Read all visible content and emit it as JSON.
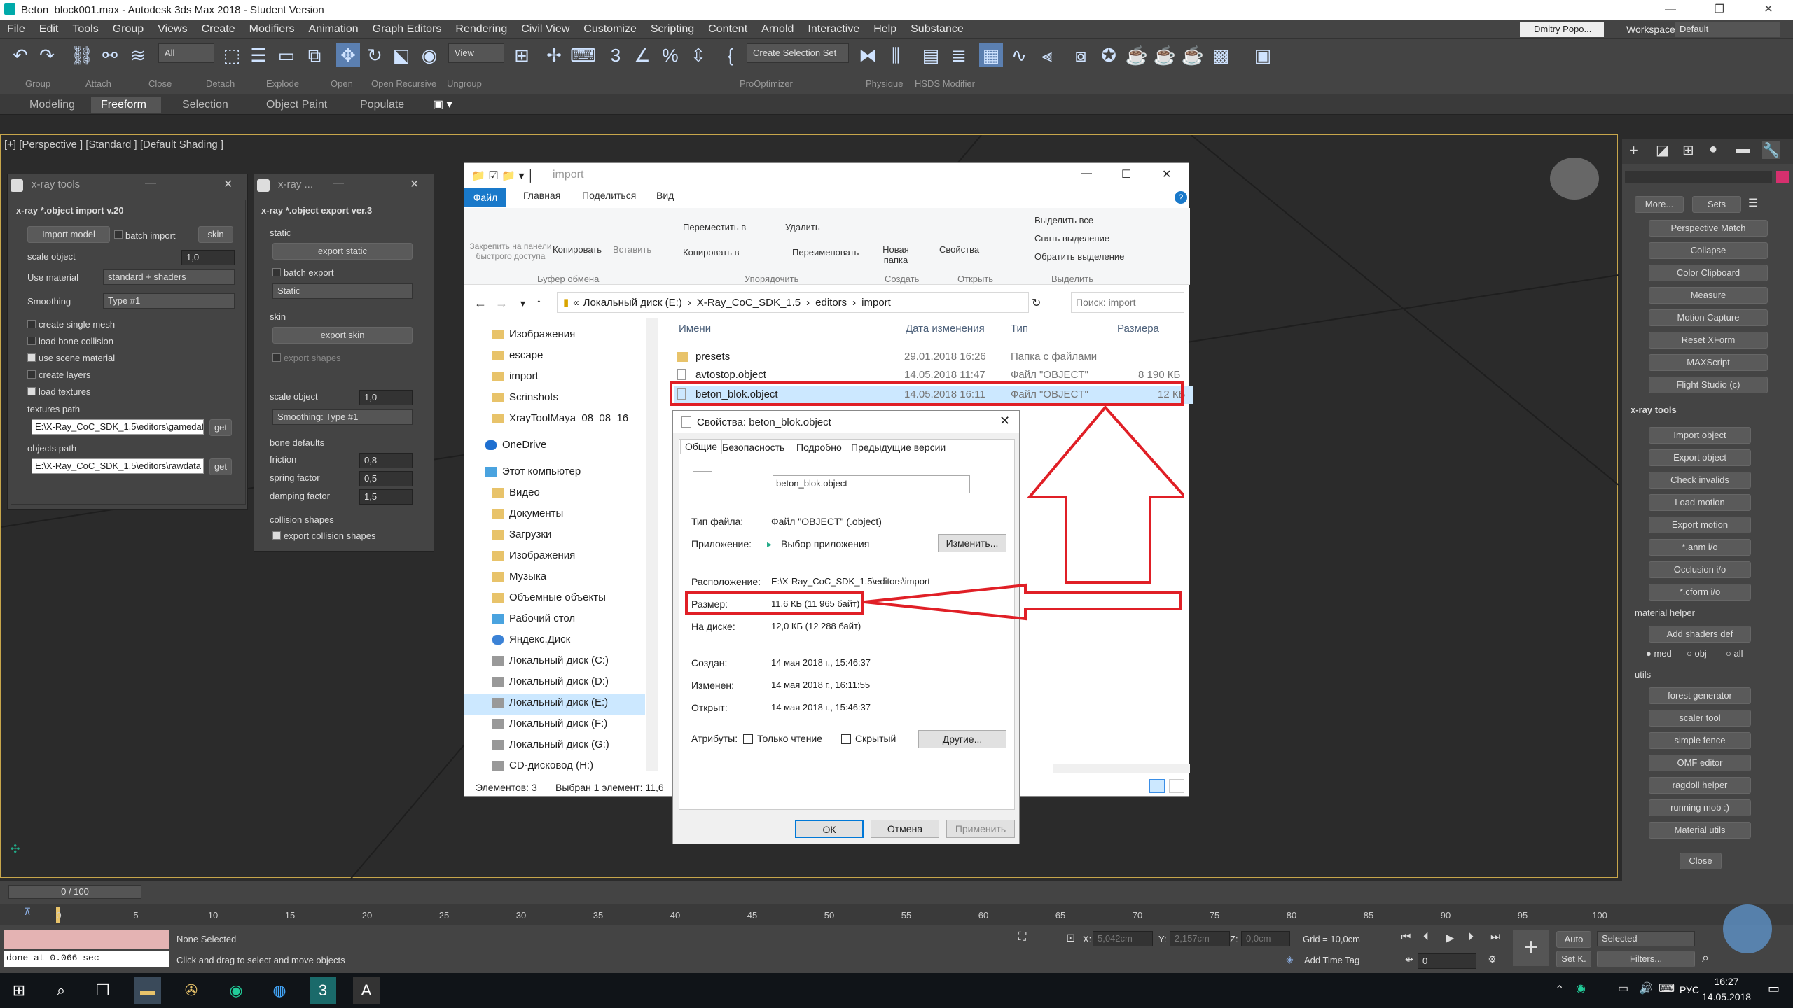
{
  "titlebar": {
    "title": "Beton_block001.max - Autodesk 3ds Max 2018 - Student Version"
  },
  "menu": [
    "File",
    "Edit",
    "Tools",
    "Group",
    "Views",
    "Create",
    "Modifiers",
    "Animation",
    "Graph Editors",
    "Rendering",
    "Civil View",
    "Customize",
    "Scripting",
    "Content",
    "Arnold",
    "Interactive",
    "Help",
    "Substance"
  ],
  "user": {
    "name": "Dmitry Popo...",
    "workspaces_label": "Workspaces:",
    "workspace": "Default"
  },
  "toolbar": {
    "filter": "All",
    "view": "View",
    "selection_set": "Create Selection Set"
  },
  "second_toolbar": [
    "Group",
    "Attach",
    "Close",
    "Detach",
    "Explode",
    "Open",
    "Open Recursive",
    "Ungroup",
    "ProOptimizer",
    "Physique",
    "HSDS Modifier"
  ],
  "ribbon": {
    "tabs": [
      "Modeling",
      "Freeform",
      "Selection",
      "Object Paint",
      "Populate"
    ],
    "active": "Freeform"
  },
  "viewport": {
    "label": "[+] [Perspective ] [Standard ] [Default Shading ]"
  },
  "xray_import": {
    "window_title": "x-ray tools",
    "rollout": "x-ray *.object import v.20",
    "import_model": "Import model",
    "batch_import": "batch import",
    "skin": "skin",
    "scale_label": "scale object",
    "scale_value": "1,0",
    "use_material_label": "Use material",
    "use_material_value": "standard + shaders",
    "smoothing_label": "Smoothing",
    "smoothing_value": "Type #1",
    "checks": [
      "create single mesh",
      "load bone collision",
      "use scene material",
      "create layers",
      "load textures"
    ],
    "textures_path_label": "textures path",
    "textures_path": "E:\\X-Ray_CoC_SDK_1.5\\editors\\gamedat",
    "objects_path_label": "objects path",
    "objects_path": "E:\\X-Ray_CoC_SDK_1.5\\editors\\rawdata",
    "get": "get"
  },
  "xray_export": {
    "window_title": "x-ray ...",
    "rollout": "x-ray *.object export ver.3",
    "static_label": "static",
    "export_static": "export static",
    "batch_export": "batch export",
    "static_value": "Static",
    "skin_label": "skin",
    "export_skin": "export skin",
    "export_shapes": "export shapes",
    "scale_label": "scale object",
    "scale_value": "1,0",
    "smoothing_value": "Smoothing: Type #1",
    "bone_defaults": "bone defaults",
    "friction_label": "friction",
    "friction": "0,8",
    "spring_label": "spring factor",
    "spring": "0,5",
    "damping_label": "damping factor",
    "damping": "1,5",
    "collision_label": "collision shapes",
    "collision_export": "export collision shapes"
  },
  "explorer": {
    "title": "import",
    "tabs": [
      "Файл",
      "Главная",
      "Поделиться",
      "Вид"
    ],
    "ribbon_buttons": {
      "pin": "Закрепить на панели быстрого доступа",
      "copy": "Копировать",
      "paste": "Вставить",
      "move_to": "Переместить в",
      "copy_to": "Копировать в",
      "delete": "Удалить",
      "rename": "Переименовать",
      "new_folder": "Новая папка",
      "properties": "Свойства",
      "select_all": "Выделить все",
      "deselect": "Снять выделение",
      "invert": "Обратить выделение"
    },
    "groups": [
      "Буфер обмена",
      "Упорядочить",
      "Создать",
      "Открыть",
      "Выделить"
    ],
    "breadcrumb": [
      "Локальный диск (E:)",
      "X-Ray_CoC_SDK_1.5",
      "editors",
      "import"
    ],
    "search_placeholder": "Поиск: import",
    "nav": [
      "Изображения",
      "escape",
      "import",
      "Scrinshots",
      "XrayToolMaya_08_08_16",
      "OneDrive",
      "Этот компьютер",
      "Видео",
      "Документы",
      "Загрузки",
      "Изображения",
      "Музыка",
      "Объемные объекты",
      "Рабочий стол",
      "Яндекс.Диск",
      "Локальный диск (C:)",
      "Локальный диск (D:)",
      "Локальный диск (E:)",
      "Локальный диск (F:)",
      "Локальный диск (G:)",
      "CD-дисковод (H:)"
    ],
    "columns": [
      "Имени",
      "Дата изменения",
      "Тип",
      "Размера"
    ],
    "files": [
      {
        "name": "presets",
        "date": "29.01.2018 16:26",
        "type": "Папка с файлами",
        "size": ""
      },
      {
        "name": "avtostop.object",
        "date": "14.05.2018 11:47",
        "type": "Файл \"OBJECT\"",
        "size": "8 190 КБ"
      },
      {
        "name": "beton_blok.object",
        "date": "14.05.2018 16:11",
        "type": "Файл \"OBJECT\"",
        "size": "12 КБ"
      }
    ],
    "status_items": "Элементов: 3",
    "status_selected": "Выбран 1 элемент: 11,6"
  },
  "props": {
    "title": "Свойства: beton_blok.object",
    "tabs": [
      "Общие",
      "Безопасность",
      "Подробно",
      "Предыдущие версии"
    ],
    "filename": "beton_blok.object",
    "type_label": "Тип файла:",
    "type_value": "Файл \"OBJECT\" (.object)",
    "app_label": "Приложение:",
    "app_value": "Выбор приложения",
    "change": "Изменить...",
    "loc_label": "Расположение:",
    "loc_value": "E:\\X-Ray_CoC_SDK_1.5\\editors\\import",
    "size_label": "Размер:",
    "size_value": "11,6 КБ (11 965 байт)",
    "disk_label": "На диске:",
    "disk_value": "12,0 КБ (12 288 байт)",
    "created_label": "Создан:",
    "created_value": "14 мая 2018 г., 15:46:37",
    "modified_label": "Изменен:",
    "modified_value": "14 мая 2018 г., 16:11:55",
    "opened_label": "Открыт:",
    "opened_value": "14 мая 2018 г., 15:46:37",
    "attr_label": "Атрибуты:",
    "readonly": "Только чтение",
    "hidden": "Скрытый",
    "other": "Другие...",
    "ok": "ОК",
    "cancel": "Отмена",
    "apply": "Применить"
  },
  "cmdpanel": {
    "more": "More...",
    "sets": "Sets",
    "buttons": [
      "Perspective Match",
      "Collapse",
      "Color Clipboard",
      "Measure",
      "Motion Capture",
      "Reset XForm",
      "MAXScript",
      "Flight Studio (c)"
    ],
    "xray_rollout": "x-ray tools",
    "xray_buttons": [
      "Import object",
      "Export object",
      "Check invalids",
      "Load motion",
      "Export motion",
      "*.anm i/o",
      "Occlusion i/o",
      "*.cform i/o"
    ],
    "material_helper": "material helper",
    "add_shaders": "Add shaders def",
    "radios": [
      "med",
      "obj",
      "all"
    ],
    "utils": "utils",
    "utils_buttons": [
      "forest generator",
      "scaler tool",
      "simple fence",
      "OMF editor",
      "ragdoll helper",
      "running mob :)",
      "Material utils"
    ],
    "close": "Close"
  },
  "timeline": {
    "frame": "0 / 100",
    "ticks": [
      "0",
      "5",
      "10",
      "15",
      "20",
      "25",
      "30",
      "35",
      "40",
      "45",
      "50",
      "55",
      "60",
      "65",
      "70",
      "75",
      "80",
      "85",
      "90",
      "95",
      "100"
    ]
  },
  "status": {
    "maxscript_out": "done at 0.066 sec",
    "selection": "None Selected",
    "hint": "Click and drag to select and move objects",
    "x_label": "X:",
    "x": "5,042cm",
    "y_label": "Y:",
    "y": "2,157cm",
    "z_label": "Z:",
    "z": "0,0cm",
    "grid": "Grid = 10,0cm",
    "add_time_tag": "Add Time Tag",
    "auto": "Auto",
    "selected": "Selected",
    "setk": "Set K.",
    "filters": "Filters...",
    "frame_spinner": "0"
  },
  "taskbar": {
    "lang": "РУС",
    "time": "16:27",
    "date": "14.05.2018"
  }
}
